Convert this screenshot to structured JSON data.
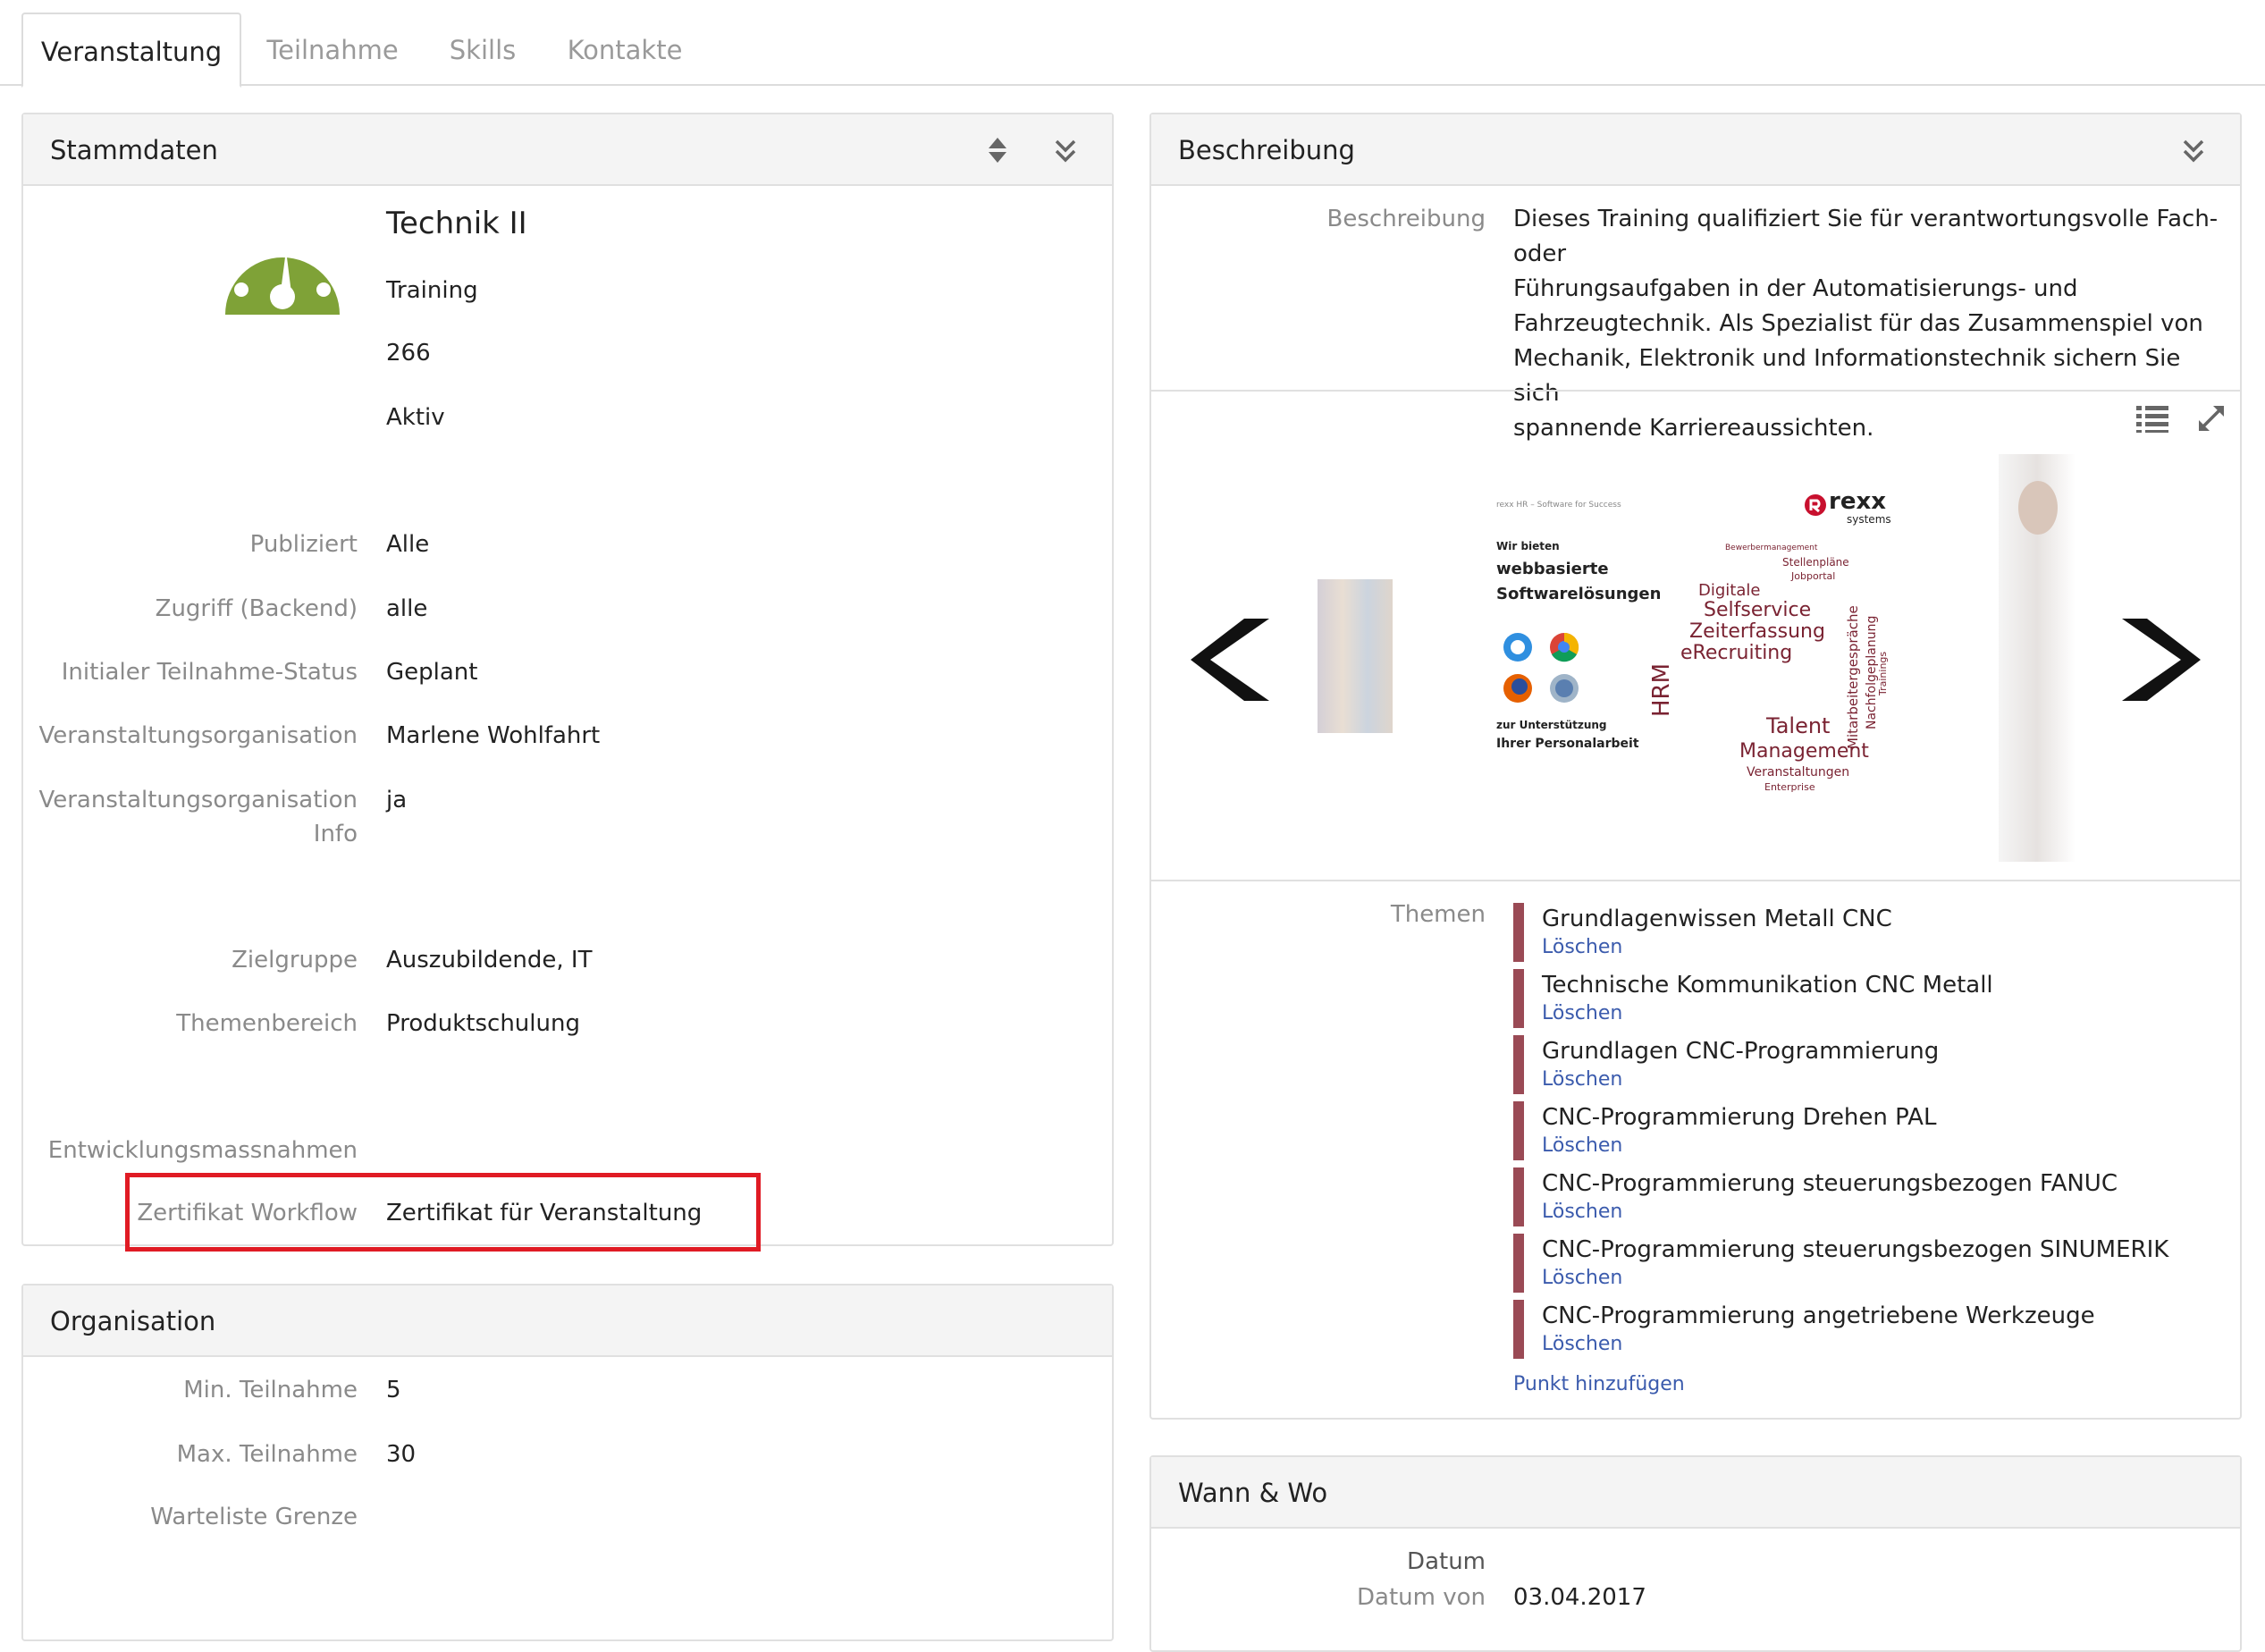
{
  "tabs": [
    {
      "label": "Veranstaltung",
      "active": true
    },
    {
      "label": "Teilnahme",
      "active": false
    },
    {
      "label": "Skills",
      "active": false
    },
    {
      "label": "Kontakte",
      "active": false
    }
  ],
  "stammdaten": {
    "title": "Stammdaten",
    "icon": "speedometer-icon",
    "icon_color": "#7fa237",
    "name": "Technik II",
    "type": "Training",
    "number": "266",
    "status": "Aktiv",
    "fields": [
      {
        "label": "Publiziert",
        "value": "Alle"
      },
      {
        "label": "Zugriff (Backend)",
        "value": "alle"
      },
      {
        "label": "Initialer Teilnahme-Status",
        "value": "Geplant"
      },
      {
        "label": "Veranstaltungsorganisation",
        "value": "Marlene Wohlfahrt"
      },
      {
        "label": "Veranstaltungsorganisation Info",
        "value": "ja"
      },
      {
        "label": "Zielgruppe",
        "value": "Auszubildende, IT"
      },
      {
        "label": "Themenbereich",
        "value": "Produktschulung"
      },
      {
        "label": "Entwicklungsmassnahmen",
        "value": ""
      },
      {
        "label": "Zertifikat Workflow",
        "value": "Zertifikat für Veranstaltung"
      }
    ],
    "highlight_color": "#e01b24"
  },
  "organisation": {
    "title": "Organisation",
    "fields": [
      {
        "label": "Min. Teilnahme",
        "value": "5"
      },
      {
        "label": "Max. Teilnahme",
        "value": "30"
      },
      {
        "label": "Warteliste Grenze",
        "value": ""
      }
    ]
  },
  "beschreibung": {
    "title": "Beschreibung",
    "label": "Beschreibung",
    "text_lines": [
      "Dieses Training qualifiziert Sie für verantwortungsvolle Fach- oder",
      "Führungsaufgaben in der Automatisierungs- und",
      "Fahrzeugtechnik. Als Spezialist für das Zusammenspiel von",
      "Mechanik, Elektronik und Informationstechnik sichern Sie sich",
      "spannende Karriereaussichten."
    ]
  },
  "carousel": {
    "slide": {
      "header": "rexx HR – Software for Success",
      "brand": "rexx",
      "brand_sub": "systems",
      "line1": "Wir bieten",
      "line2": "webbasierte",
      "line3": "Softwarelösungen",
      "line4": "zur Unterstützung",
      "line5": "Ihrer Personalarbeit",
      "words": [
        "Digitale",
        "Selfservice",
        "Zeiterfassung",
        "eRecruiting",
        "HRM",
        "Talent",
        "Management",
        "Veranstaltungen",
        "Enterprise",
        "Mitarbeitergespräche",
        "Stellenpläne",
        "Jobportal",
        "Nachfolgeplanung",
        "Bewerbermanagement",
        "Trainings"
      ]
    }
  },
  "themen": {
    "label": "Themen",
    "delete_label": "Löschen",
    "items": [
      "Grundlagenwissen Metall CNC",
      "Technische Kommunikation CNC Metall",
      "Grundlagen CNC-Programmierung",
      "CNC-Programmierung Drehen PAL",
      "CNC-Programmierung steuerungsbezogen FANUC",
      "CNC-Programmierung steuerungsbezogen SINUMERIK",
      "CNC-Programmierung angetriebene Werkzeuge"
    ],
    "add_label": "Punkt hinzufügen",
    "bar_color": "#9a4a55"
  },
  "wann_wo": {
    "title": "Wann & Wo",
    "section_label": "Datum",
    "fields": [
      {
        "label": "Datum von",
        "value": "03.04.2017"
      }
    ]
  }
}
